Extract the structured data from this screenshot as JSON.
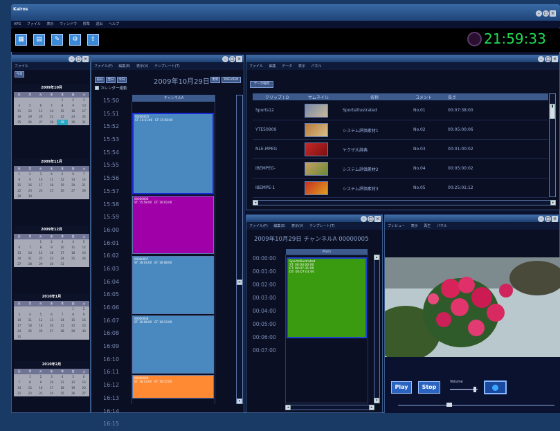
{
  "app": {
    "title": "Kairos",
    "clock": "21:59:33",
    "accent": "#22dd55"
  },
  "main_menu": [
    "APG",
    "ファイル",
    "表示",
    "ウィンドウ",
    "標準",
    "送出",
    "ヘルプ"
  ],
  "toolbar_icons": [
    "calendar-icon",
    "grid-icon",
    "edit-icon",
    "tools-icon",
    "export-icon"
  ],
  "calendar_panel": {
    "menu": "ファイル",
    "today_label": "今日",
    "months": [
      {
        "title": "2009年10月",
        "days": [
          "",
          "",
          "",
          "",
          "1",
          "2",
          "3",
          "4",
          "5",
          "6",
          "7",
          "8",
          "9",
          "10",
          "11",
          "12",
          "13",
          "14",
          "15",
          "16",
          "17",
          "18",
          "19",
          "20",
          "21",
          "22",
          "23",
          "24",
          "25",
          "26",
          "27",
          "28",
          "29",
          "30",
          "31"
        ],
        "selected": "29"
      },
      {
        "title": "2009年11月",
        "days": [
          "1",
          "2",
          "3",
          "4",
          "5",
          "6",
          "7",
          "8",
          "9",
          "10",
          "11",
          "12",
          "13",
          "14",
          "15",
          "16",
          "17",
          "18",
          "19",
          "20",
          "21",
          "22",
          "23",
          "24",
          "25",
          "26",
          "27",
          "28",
          "29",
          "30"
        ]
      },
      {
        "title": "2009年12月",
        "days": [
          "",
          "",
          "1",
          "2",
          "3",
          "4",
          "5",
          "6",
          "7",
          "8",
          "9",
          "10",
          "11",
          "12",
          "13",
          "14",
          "15",
          "16",
          "17",
          "18",
          "19",
          "20",
          "21",
          "22",
          "23",
          "24",
          "25",
          "26",
          "27",
          "28",
          "29",
          "30",
          "31"
        ]
      },
      {
        "title": "2010年1月",
        "days": [
          "",
          "",
          "",
          "",
          "",
          "1",
          "2",
          "3",
          "4",
          "5",
          "6",
          "7",
          "8",
          "9",
          "10",
          "11",
          "12",
          "13",
          "14",
          "15",
          "16",
          "17",
          "18",
          "19",
          "20",
          "21",
          "22",
          "23",
          "24",
          "25",
          "26",
          "27",
          "28",
          "29",
          "30",
          "31"
        ]
      },
      {
        "title": "2010年2月",
        "days": [
          "",
          "1",
          "2",
          "3",
          "4",
          "5",
          "6",
          "7",
          "8",
          "9",
          "10",
          "11",
          "12",
          "13",
          "14",
          "15",
          "16",
          "17",
          "18",
          "19",
          "20",
          "21",
          "22",
          "23",
          "24",
          "25",
          "26",
          "27"
        ]
      }
    ],
    "weekdays": [
      "日",
      "月",
      "火",
      "水",
      "木",
      "金",
      "土"
    ]
  },
  "schedule_panel": {
    "menu": [
      "ファイル(F)",
      "編集(E)",
      "表示(V)",
      "テンプレート(T)"
    ],
    "nav_buttons": [
      "前日",
      "翌日",
      "今日"
    ],
    "date": "2009年10月29日",
    "right_buttons": [
      "更新",
      "PREVIEW"
    ],
    "calendar_link_label": "カレンダー連動",
    "channel": "チャンネルA",
    "times": [
      "15:50",
      "15:51",
      "15:52",
      "15:53",
      "15:54",
      "15:55",
      "15:56",
      "15:57",
      "15:58",
      "15:59",
      "16:00",
      "16:01",
      "16:02",
      "16:03",
      "16:04",
      "16:05",
      "16:06",
      "16:07",
      "16:08",
      "16:09",
      "16:10",
      "16:11",
      "16:12",
      "16:13",
      "16:14",
      "16:15"
    ],
    "events": [
      {
        "id": "00000005",
        "st": "ST: 15:51:00",
        "et": "ET: 15:58:00",
        "color": "#4a89bf"
      },
      {
        "id": "00000006",
        "st": "ST: 15:58:00",
        "et": "ET: 16:03:00",
        "color": "#a000a8"
      },
      {
        "id": "00000007",
        "st": "ST: 16:03:00",
        "et": "ET: 16:08:00",
        "color": "#4a89bf"
      },
      {
        "id": "00000008",
        "st": "ST: 16:08:00",
        "et": "ET: 16:13:00",
        "color": "#4a89bf"
      },
      {
        "id": "00000009",
        "st": "ST: 16:13:00",
        "et": "ET: 16:15:00",
        "color": "#ff8a33"
      }
    ]
  },
  "clip_panel": {
    "menu": [
      "ファイル",
      "編集",
      "データ",
      "表示",
      "パネル"
    ],
    "update_button": "データ取得",
    "columns": [
      "クリップ I D",
      "サムネイル",
      "名称",
      "コメント",
      "長さ"
    ],
    "rows": [
      {
        "id": "Sports12",
        "name": "SportsIllustrated",
        "comment": "No.01",
        "length": "00:07:38:00"
      },
      {
        "id": "YTE50909",
        "name": "システム評価素材1",
        "comment": "No.02",
        "length": "00:05:00:06"
      },
      {
        "id": "NLE-MPEG",
        "name": "ヤクザ大辞典",
        "comment": "No.03",
        "length": "00:01:00:02"
      },
      {
        "id": "IBEMPEG-",
        "name": "システム評価素材2",
        "comment": "No.04",
        "length": "00:05:00:02"
      },
      {
        "id": "IBEMPE-1",
        "name": "システム評価素材3",
        "comment": "No.05",
        "length": "00:25:01:12"
      }
    ]
  },
  "detail_panel": {
    "menu": [
      "ファイル(F)",
      "編集(E)",
      "表示(V)",
      "テンプレート(T)"
    ],
    "header": "2009年10月29日 チャンネルA 00000005",
    "track_label": "Main",
    "times": [
      "00:00:00",
      "00:01:00",
      "00:02:00",
      "00:03:00",
      "00:04:00",
      "00:05:00",
      "00:06:00",
      "00:07:00"
    ],
    "clip": {
      "name": "SportsIllustrated",
      "in": "ST:  00:00:00:00",
      "out": "ET:  00:07:31:00",
      "dur": "DT:  00:07:01:00"
    }
  },
  "preview_panel": {
    "menu": [
      "プレビュー",
      "表示",
      "再生",
      "パネル"
    ],
    "play": "Play",
    "stop": "Stop",
    "volume_label": "Volume"
  }
}
